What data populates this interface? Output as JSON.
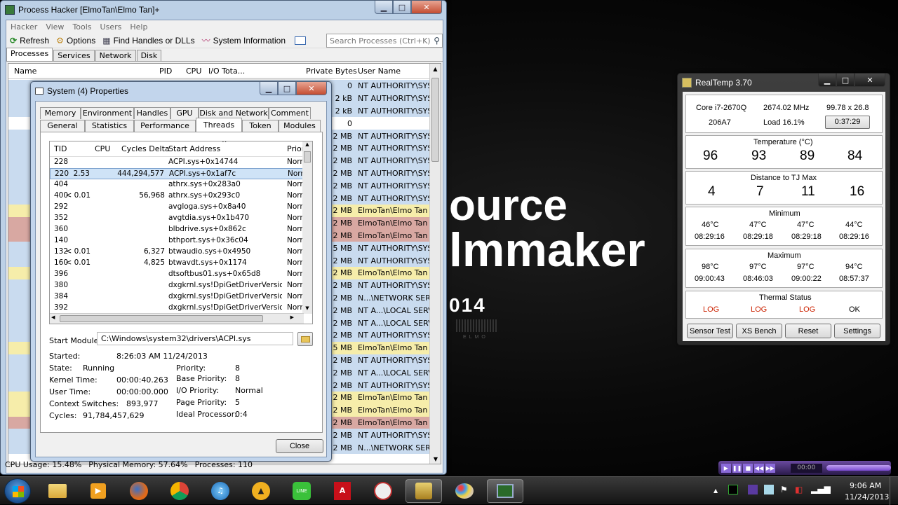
{
  "wallpaper": {
    "line1": "ource",
    "line2": "lmmaker",
    "line3": "014",
    "mark": "ELMO"
  },
  "ph": {
    "title": "Process Hacker [ElmoTan\\Elmo Tan]+",
    "menu": [
      "Hacker",
      "View",
      "Tools",
      "Users",
      "Help"
    ],
    "toolbar": {
      "refresh": "Refresh",
      "options": "Options",
      "find": "Find Handles or DLLs",
      "sysinfo": "System Information"
    },
    "search_placeholder": "Search Processes (Ctrl+K)",
    "tabs": [
      "Processes",
      "Services",
      "Network",
      "Disk"
    ],
    "cols": {
      "name": "Name",
      "pid": "PID",
      "cpu": "CPU",
      "io": "I/O Tota...",
      "private": "Private Bytes",
      "user": "User Name"
    },
    "rows": [
      {
        "pb": "0",
        "user": "NT AUTHORITY\\SYST",
        "color": "#c9dbef"
      },
      {
        "pb": "2 kB",
        "user": "NT AUTHORITY\\SYST",
        "color": "#c9dbef"
      },
      {
        "pb": "2 kB",
        "user": "NT AUTHORITY\\SYST",
        "color": "#c9dbef"
      },
      {
        "pb": "0",
        "user": "",
        "color": "#ffffff"
      },
      {
        "pb": "2 MB",
        "user": "NT AUTHORITY\\SYST",
        "color": "#c9dbef"
      },
      {
        "pb": "2 MB",
        "user": "NT AUTHORITY\\SYST",
        "color": "#c9dbef"
      },
      {
        "pb": "2 MB",
        "user": "NT AUTHORITY\\SYST",
        "color": "#c9dbef"
      },
      {
        "pb": "2 MB",
        "user": "NT AUTHORITY\\SYST",
        "color": "#c9dbef"
      },
      {
        "pb": "2 MB",
        "user": "NT AUTHORITY\\SYST",
        "color": "#c9dbef"
      },
      {
        "pb": "2 MB",
        "user": "NT AUTHORITY\\SYST",
        "color": "#c9dbef"
      },
      {
        "pb": "2 MB",
        "user": "ElmoTan\\Elmo Tan",
        "color": "#f6edaa"
      },
      {
        "pb": "2 MB",
        "user": "ElmoTan\\Elmo Tan",
        "color": "#d8a8a2"
      },
      {
        "pb": "2 MB",
        "user": "ElmoTan\\Elmo Tan",
        "color": "#d8a8a2"
      },
      {
        "pb": "5 MB",
        "user": "NT AUTHORITY\\SYST",
        "color": "#c9dbef"
      },
      {
        "pb": "2 MB",
        "user": "NT AUTHORITY\\SYST",
        "color": "#c9dbef"
      },
      {
        "pb": "2 MB",
        "user": "ElmoTan\\Elmo Tan",
        "color": "#f6edaa"
      },
      {
        "pb": "2 MB",
        "user": "NT AUTHORITY\\SYST",
        "color": "#c9dbef"
      },
      {
        "pb": "2 MB",
        "user": "N...\\NETWORK SERVI",
        "color": "#c9dbef"
      },
      {
        "pb": "2 MB",
        "user": "NT A...\\LOCAL SERVI",
        "color": "#c9dbef"
      },
      {
        "pb": "2 MB",
        "user": "NT A...\\LOCAL SERVI",
        "color": "#c9dbef"
      },
      {
        "pb": "2 MB",
        "user": "NT AUTHORITY\\SYST",
        "color": "#c9dbef"
      },
      {
        "pb": "5 MB",
        "user": "ElmoTan\\Elmo Tan",
        "color": "#f6edaa"
      },
      {
        "pb": "2 MB",
        "user": "NT AUTHORITY\\SYST",
        "color": "#c9dbef"
      },
      {
        "pb": "2 MB",
        "user": "NT A...\\LOCAL SERVI",
        "color": "#c9dbef"
      },
      {
        "pb": "2 MB",
        "user": "NT AUTHORITY\\SYST",
        "color": "#c9dbef"
      },
      {
        "pb": "2 MB",
        "user": "ElmoTan\\Elmo Tan",
        "color": "#f6edaa"
      },
      {
        "pb": "2 MB",
        "user": "ElmoTan\\Elmo Tan",
        "color": "#f6edaa"
      },
      {
        "pb": "2 MB",
        "user": "ElmoTan\\Elmo Tan",
        "color": "#d8a8a2"
      },
      {
        "pb": "2 MB",
        "user": "NT AUTHORITY\\SYST",
        "color": "#c9dbef"
      },
      {
        "pb": "2 MB",
        "user": "N...\\NETWORK SERVI",
        "color": "#c9dbef"
      }
    ],
    "status": {
      "cpu": "CPU Usage: 15.48%",
      "mem": "Physical Memory: 57.64%",
      "procs": "Processes: 110"
    }
  },
  "dlg": {
    "title": "System (4) Properties",
    "tabs_row1": [
      "Memory",
      "Environment",
      "Handles",
      "GPU",
      "Disk and Network",
      "Comment"
    ],
    "tabs_row2": [
      "General",
      "Statistics",
      "Performance",
      "Threads",
      "Token",
      "Modules"
    ],
    "cols": {
      "tid": "TID",
      "cpu": "CPU",
      "delta": "Cycles Delta",
      "addr": "Start Address",
      "prio": "Prior"
    },
    "threads": [
      {
        "tid": "228",
        "cpu": "",
        "delta": "",
        "addr": "ACPI.sys+0x14744",
        "prio": "Norn"
      },
      {
        "tid": "220",
        "cpu": "2.53",
        "delta": "444,294,577",
        "addr": "ACPI.sys+0x1af7c",
        "prio": "Norn"
      },
      {
        "tid": "404",
        "cpu": "",
        "delta": "",
        "addr": "athrx.sys+0x283a0",
        "prio": "Norn"
      },
      {
        "tid": "400",
        "cpu": "< 0.01",
        "delta": "56,968",
        "addr": "athrx.sys+0x293c0",
        "prio": "Norn"
      },
      {
        "tid": "292",
        "cpu": "",
        "delta": "",
        "addr": "avgloga.sys+0x8a40",
        "prio": "Norn"
      },
      {
        "tid": "352",
        "cpu": "",
        "delta": "",
        "addr": "avgtdia.sys+0x1b470",
        "prio": "Norn"
      },
      {
        "tid": "360",
        "cpu": "",
        "delta": "",
        "addr": "blbdrive.sys+0x862c",
        "prio": "Norn"
      },
      {
        "tid": "140",
        "cpu": "",
        "delta": "",
        "addr": "bthport.sys+0x36c04",
        "prio": "Norn"
      },
      {
        "tid": "132",
        "cpu": "< 0.01",
        "delta": "6,327",
        "addr": "btwaudio.sys+0x4950",
        "prio": "Norn"
      },
      {
        "tid": "160",
        "cpu": "< 0.01",
        "delta": "4,825",
        "addr": "btwavdt.sys+0x1174",
        "prio": "Norn"
      },
      {
        "tid": "396",
        "cpu": "",
        "delta": "",
        "addr": "dtsoftbus01.sys+0x65d8",
        "prio": "Norn"
      },
      {
        "tid": "380",
        "cpu": "",
        "delta": "",
        "addr": "dxgkrnl.sys!DpiGetDriverVersion...",
        "prio": "Norn"
      },
      {
        "tid": "384",
        "cpu": "",
        "delta": "",
        "addr": "dxgkrnl.sys!DpiGetDriverVersion...",
        "prio": "Norn"
      },
      {
        "tid": "392",
        "cpu": "",
        "delta": "",
        "addr": "dxgkrnl.sys!DpiGetDriverVersion...",
        "prio": "Norn"
      }
    ],
    "start_module_label": "Start Module:",
    "start_module": "C:\\Windows\\system32\\drivers\\ACPI.sys",
    "started_label": "Started:",
    "started": "8:26:03 AM 11/24/2013",
    "state_label": "State:",
    "state": "Running",
    "kernel_label": "Kernel Time:",
    "kernel": "00:00:40.263",
    "user_label": "User Time:",
    "user": "00:00:00.000",
    "ctx_label": "Context Switches:",
    "ctx": "893,977",
    "cycles_label": "Cycles:",
    "cycles": "91,784,457,629",
    "prio_label": "Priority:",
    "prio": "8",
    "bprio_label": "Base Priority:",
    "bprio": "8",
    "ioprio_label": "I/O Priority:",
    "ioprio": "Normal",
    "pgprio_label": "Page Priority:",
    "pgprio": "5",
    "ideal_label": "Ideal Processor:",
    "ideal": "0:4",
    "close": "Close"
  },
  "rt": {
    "title": "RealTemp 3.70",
    "cpu": "Core i7-2670Q",
    "mhz": "2674.02 MHz",
    "mult": "99.78 x 26.8",
    "id": "206A7",
    "load": "Load  16.1%",
    "timer": "0:37:29",
    "temp_label": "Temperature (°C)",
    "temps": [
      "96",
      "93",
      "89",
      "84"
    ],
    "tj_label": "Distance to TJ Max",
    "tj": [
      "4",
      "7",
      "11",
      "16"
    ],
    "min_label": "Minimum",
    "min": [
      "46°C",
      "47°C",
      "47°C",
      "44°C"
    ],
    "min_t": [
      "08:29:16",
      "08:29:18",
      "08:29:18",
      "08:29:16"
    ],
    "max_label": "Maximum",
    "max": [
      "98°C",
      "97°C",
      "97°C",
      "94°C"
    ],
    "max_t": [
      "09:00:43",
      "08:46:03",
      "09:00:22",
      "08:57:37"
    ],
    "thermal_label": "Thermal Status",
    "thermal": [
      "LOG",
      "LOG",
      "LOG",
      "OK"
    ],
    "buttons": [
      "Sensor Test",
      "XS Bench",
      "Reset",
      "Settings"
    ]
  },
  "player": {
    "time": "00:00"
  },
  "tray": {
    "time": "9:06 AM",
    "date": "11/24/2013"
  }
}
